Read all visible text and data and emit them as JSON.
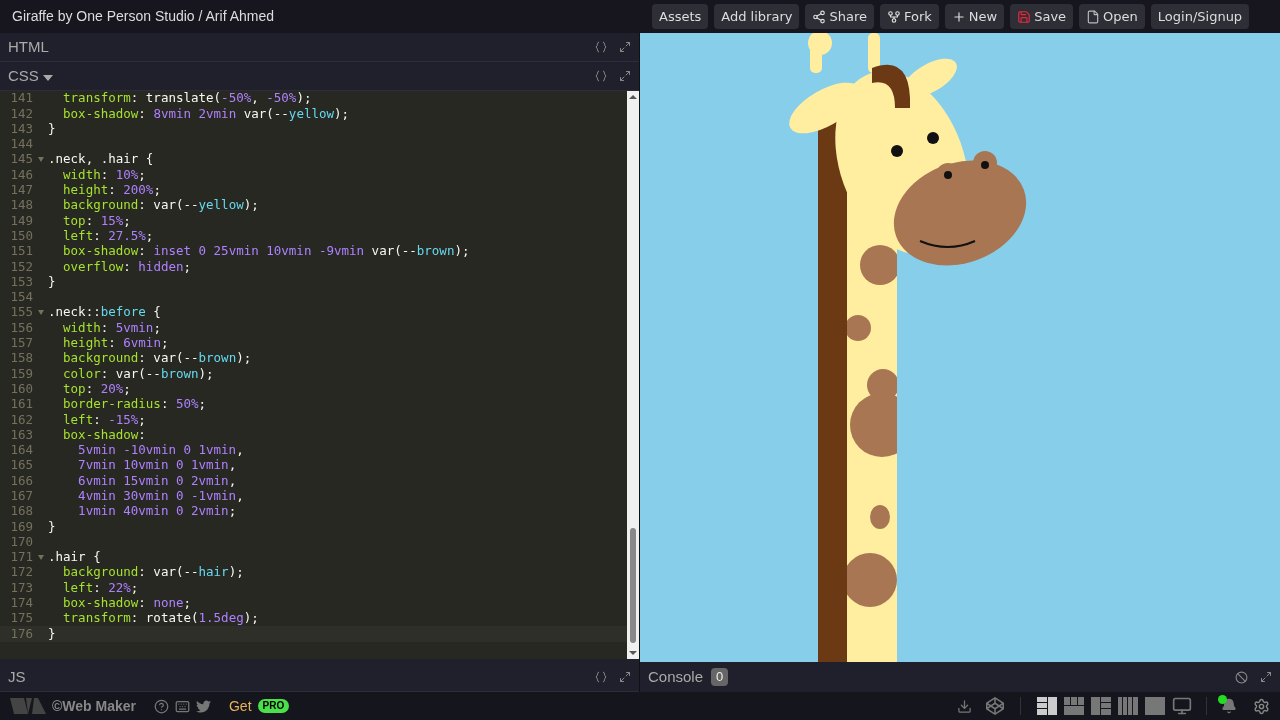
{
  "title": "Giraffe by One Person Studio / Arif Ahmed",
  "toolbar": [
    {
      "label": "Assets"
    },
    {
      "label": "Add library"
    },
    {
      "label": "Share"
    },
    {
      "label": "Fork"
    },
    {
      "label": "New"
    },
    {
      "label": "Save"
    },
    {
      "label": "Open"
    },
    {
      "label": "Login/Signup"
    }
  ],
  "panes": {
    "html": {
      "label": "HTML"
    },
    "css": {
      "label": "CSS"
    },
    "js": {
      "label": "JS"
    }
  },
  "code": [
    {
      "num": "141",
      "fold": false,
      "active": false,
      "tokens": [
        {
          "kind": "prop",
          "text": "  transform"
        },
        {
          "kind": "plain",
          "text": ": translate("
        },
        {
          "kind": "num",
          "text": "-50%"
        },
        {
          "kind": "plain",
          "text": ", "
        },
        {
          "kind": "num",
          "text": "-50%"
        },
        {
          "kind": "plain",
          "text": ");"
        }
      ]
    },
    {
      "num": "142",
      "fold": false,
      "active": false,
      "tokens": [
        {
          "kind": "prop",
          "text": "  box-shadow"
        },
        {
          "kind": "plain",
          "text": ": "
        },
        {
          "kind": "num",
          "text": "8vmin 2vmin"
        },
        {
          "kind": "plain",
          "text": " var(--"
        },
        {
          "kind": "var",
          "text": "yellow"
        },
        {
          "kind": "plain",
          "text": ");"
        }
      ]
    },
    {
      "num": "143",
      "fold": false,
      "active": false,
      "tokens": [
        {
          "kind": "plain",
          "text": "}"
        }
      ]
    },
    {
      "num": "144",
      "fold": false,
      "active": false
    },
    {
      "num": "145",
      "fold": true,
      "active": false,
      "tokens": [
        {
          "kind": "plain",
          "text": ".neck, .hair {"
        }
      ]
    },
    {
      "num": "146",
      "fold": false,
      "active": false,
      "tokens": [
        {
          "kind": "prop",
          "text": "  width"
        },
        {
          "kind": "plain",
          "text": ": "
        },
        {
          "kind": "num",
          "text": "10%"
        },
        {
          "kind": "plain",
          "text": ";"
        }
      ]
    },
    {
      "num": "147",
      "fold": false,
      "active": false,
      "tokens": [
        {
          "kind": "prop",
          "text": "  height"
        },
        {
          "kind": "plain",
          "text": ": "
        },
        {
          "kind": "num",
          "text": "200%"
        },
        {
          "kind": "plain",
          "text": ";"
        }
      ]
    },
    {
      "num": "148",
      "fold": false,
      "active": false,
      "tokens": [
        {
          "kind": "prop",
          "text": "  background"
        },
        {
          "kind": "plain",
          "text": ": var(--"
        },
        {
          "kind": "var",
          "text": "yellow"
        },
        {
          "kind": "plain",
          "text": ");"
        }
      ]
    },
    {
      "num": "149",
      "fold": false,
      "active": false,
      "tokens": [
        {
          "kind": "prop",
          "text": "  top"
        },
        {
          "kind": "plain",
          "text": ": "
        },
        {
          "kind": "num",
          "text": "15%"
        },
        {
          "kind": "plain",
          "text": ";"
        }
      ]
    },
    {
      "num": "150",
      "fold": false,
      "active": false,
      "tokens": [
        {
          "kind": "prop",
          "text": "  left"
        },
        {
          "kind": "plain",
          "text": ": "
        },
        {
          "kind": "num",
          "text": "27.5%"
        },
        {
          "kind": "plain",
          "text": ";"
        }
      ]
    },
    {
      "num": "151",
      "fold": false,
      "active": false,
      "tokens": [
        {
          "kind": "prop",
          "text": "  box-shadow"
        },
        {
          "kind": "plain",
          "text": ": "
        },
        {
          "kind": "num",
          "text": "inset 0 25vmin 10vmin -9vmin"
        },
        {
          "kind": "plain",
          "text": " var(--"
        },
        {
          "kind": "var",
          "text": "brown"
        },
        {
          "kind": "plain",
          "text": ");"
        }
      ]
    },
    {
      "num": "152",
      "fold": false,
      "active": false,
      "tokens": [
        {
          "kind": "prop",
          "text": "  overflow"
        },
        {
          "kind": "plain",
          "text": ": "
        },
        {
          "kind": "num",
          "text": "hidden"
        },
        {
          "kind": "plain",
          "text": ";"
        }
      ]
    },
    {
      "num": "153",
      "fold": false,
      "active": false,
      "tokens": [
        {
          "kind": "plain",
          "text": "}"
        }
      ]
    },
    {
      "num": "154",
      "fold": false,
      "active": false
    },
    {
      "num": "155",
      "fold": true,
      "active": false,
      "tokens": [
        {
          "kind": "plain",
          "text": ".neck::"
        },
        {
          "kind": "var",
          "text": "before"
        },
        {
          "kind": "plain",
          "text": " {"
        }
      ]
    },
    {
      "num": "156",
      "fold": false,
      "active": false,
      "tokens": [
        {
          "kind": "prop",
          "text": "  width"
        },
        {
          "kind": "plain",
          "text": ": "
        },
        {
          "kind": "num",
          "text": "5vmin"
        },
        {
          "kind": "plain",
          "text": ";"
        }
      ]
    },
    {
      "num": "157",
      "fold": false,
      "active": false,
      "tokens": [
        {
          "kind": "prop",
          "text": "  height"
        },
        {
          "kind": "plain",
          "text": ": "
        },
        {
          "kind": "num",
          "text": "6vmin"
        },
        {
          "kind": "plain",
          "text": ";"
        }
      ]
    },
    {
      "num": "158",
      "fold": false,
      "active": false,
      "tokens": [
        {
          "kind": "prop",
          "text": "  background"
        },
        {
          "kind": "plain",
          "text": ": var(--"
        },
        {
          "kind": "var",
          "text": "brown"
        },
        {
          "kind": "plain",
          "text": ");"
        }
      ]
    },
    {
      "num": "159",
      "fold": false,
      "active": false,
      "tokens": [
        {
          "kind": "prop",
          "text": "  color"
        },
        {
          "kind": "plain",
          "text": ": var(--"
        },
        {
          "kind": "var",
          "text": "brown"
        },
        {
          "kind": "plain",
          "text": ");"
        }
      ]
    },
    {
      "num": "160",
      "fold": false,
      "active": false,
      "tokens": [
        {
          "kind": "prop",
          "text": "  top"
        },
        {
          "kind": "plain",
          "text": ": "
        },
        {
          "kind": "num",
          "text": "20%"
        },
        {
          "kind": "plain",
          "text": ";"
        }
      ]
    },
    {
      "num": "161",
      "fold": false,
      "active": false,
      "tokens": [
        {
          "kind": "prop",
          "text": "  border-radius"
        },
        {
          "kind": "plain",
          "text": ": "
        },
        {
          "kind": "num",
          "text": "50%"
        },
        {
          "kind": "plain",
          "text": ";"
        }
      ]
    },
    {
      "num": "162",
      "fold": false,
      "active": false,
      "tokens": [
        {
          "kind": "prop",
          "text": "  left"
        },
        {
          "kind": "plain",
          "text": ": "
        },
        {
          "kind": "num",
          "text": "-15%"
        },
        {
          "kind": "plain",
          "text": ";"
        }
      ]
    },
    {
      "num": "163",
      "fold": false,
      "active": false,
      "tokens": [
        {
          "kind": "prop",
          "text": "  box-shadow"
        },
        {
          "kind": "plain",
          "text": ":"
        }
      ]
    },
    {
      "num": "164",
      "fold": false,
      "active": false,
      "tokens": [
        {
          "kind": "num",
          "text": "    5vmin -10vmin 0 1vmin"
        },
        {
          "kind": "plain",
          "text": ","
        }
      ]
    },
    {
      "num": "165",
      "fold": false,
      "active": false,
      "tokens": [
        {
          "kind": "num",
          "text": "    7vmin 10vmin 0 1vmin"
        },
        {
          "kind": "plain",
          "text": ","
        }
      ]
    },
    {
      "num": "166",
      "fold": false,
      "active": false,
      "tokens": [
        {
          "kind": "num",
          "text": "    6vmin 15vmin 0 2vmin"
        },
        {
          "kind": "plain",
          "text": ","
        }
      ]
    },
    {
      "num": "167",
      "fold": false,
      "active": false,
      "tokens": [
        {
          "kind": "num",
          "text": "    4vmin 30vmin 0 -1vmin"
        },
        {
          "kind": "plain",
          "text": ","
        }
      ]
    },
    {
      "num": "168",
      "fold": false,
      "active": false,
      "tokens": [
        {
          "kind": "num",
          "text": "    1vmin 40vmin 0 2vmin"
        },
        {
          "kind": "plain",
          "text": ";"
        }
      ]
    },
    {
      "num": "169",
      "fold": false,
      "active": false,
      "tokens": [
        {
          "kind": "plain",
          "text": "}"
        }
      ]
    },
    {
      "num": "170",
      "fold": false,
      "active": false
    },
    {
      "num": "171",
      "fold": true,
      "active": false,
      "tokens": [
        {
          "kind": "plain",
          "text": ".hair {"
        }
      ]
    },
    {
      "num": "172",
      "fold": false,
      "active": false,
      "tokens": [
        {
          "kind": "prop",
          "text": "  background"
        },
        {
          "kind": "plain",
          "text": ": var(--"
        },
        {
          "kind": "var",
          "text": "hair"
        },
        {
          "kind": "plain",
          "text": ");"
        }
      ]
    },
    {
      "num": "173",
      "fold": false,
      "active": false,
      "tokens": [
        {
          "kind": "prop",
          "text": "  left"
        },
        {
          "kind": "plain",
          "text": ": "
        },
        {
          "kind": "num",
          "text": "22%"
        },
        {
          "kind": "plain",
          "text": ";"
        }
      ]
    },
    {
      "num": "174",
      "fold": false,
      "active": false,
      "tokens": [
        {
          "kind": "prop",
          "text": "  box-shadow"
        },
        {
          "kind": "plain",
          "text": ": "
        },
        {
          "kind": "num",
          "text": "none"
        },
        {
          "kind": "plain",
          "text": ";"
        }
      ]
    },
    {
      "num": "175",
      "fold": false,
      "active": false,
      "tokens": [
        {
          "kind": "prop",
          "text": "  transform"
        },
        {
          "kind": "plain",
          "text": ": rotate("
        },
        {
          "kind": "num",
          "text": "1.5deg"
        },
        {
          "kind": "plain",
          "text": ");"
        }
      ]
    },
    {
      "num": "176",
      "fold": false,
      "active": true,
      "tokens": [
        {
          "kind": "plain",
          "text": "}"
        }
      ]
    }
  ],
  "console": {
    "label": "Console",
    "count": "0"
  },
  "footer": {
    "brand": "©Web Maker",
    "get": "Get",
    "pro": "PRO",
    "layouts": [
      {
        "kind": "left",
        "selected": true
      },
      {
        "kind": "top",
        "selected": false
      },
      {
        "kind": "right",
        "selected": false
      },
      {
        "kind": "columns",
        "selected": false
      },
      {
        "kind": "full",
        "selected": false
      }
    ],
    "notification": true
  }
}
